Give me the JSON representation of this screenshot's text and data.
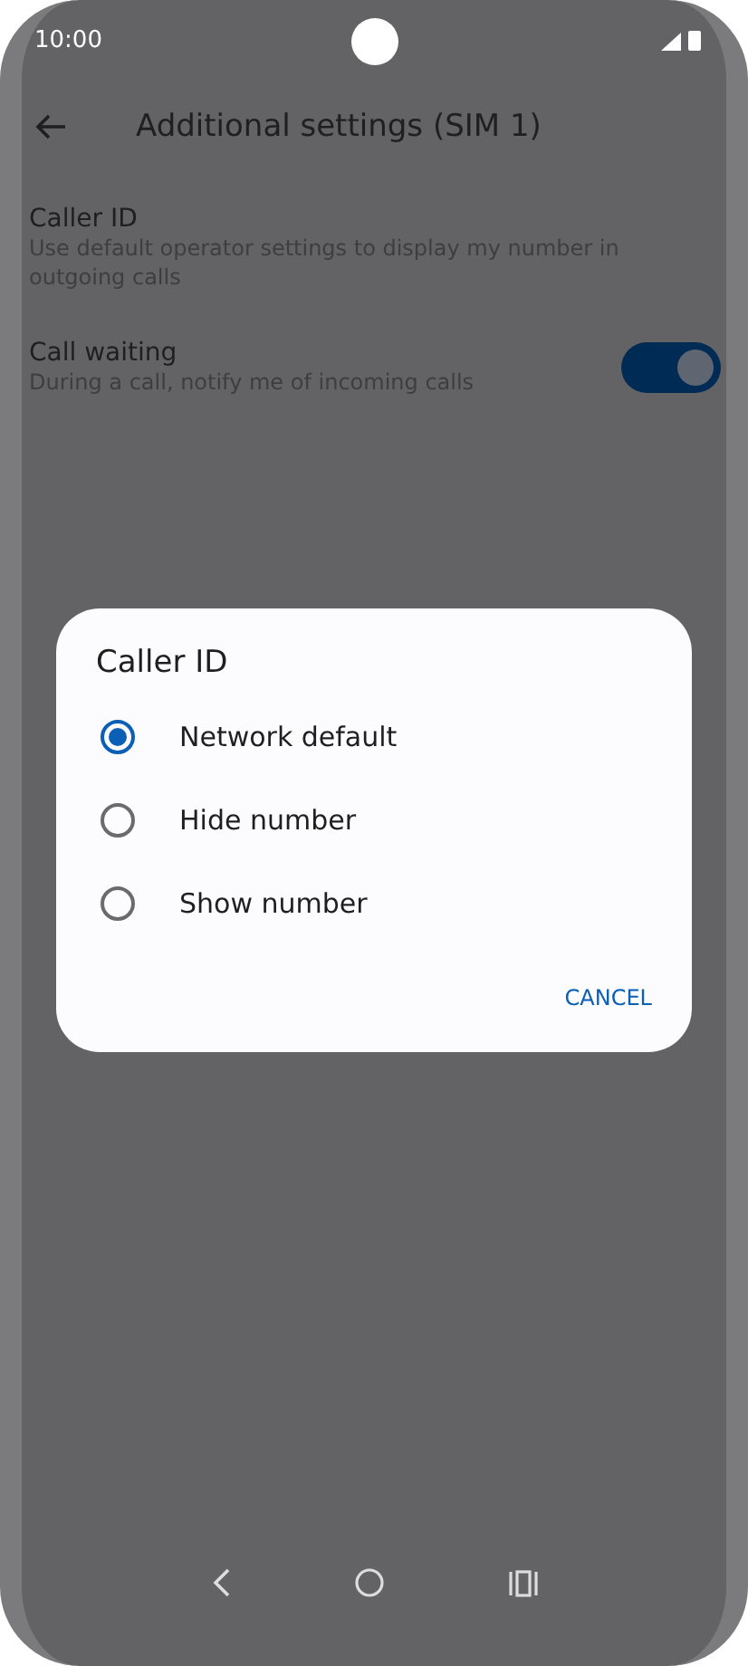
{
  "status_bar": {
    "time": "10:00"
  },
  "header": {
    "title": "Additional settings (SIM 1)"
  },
  "settings": [
    {
      "kind": "text",
      "title": "Caller ID",
      "subtitle": "Use default operator settings to display my number in outgoing calls"
    },
    {
      "kind": "switch",
      "title": "Call waiting",
      "subtitle": "During a call, notify me of incoming calls",
      "on": true
    }
  ],
  "dialog": {
    "title": "Caller ID",
    "options": [
      {
        "label": "Network default",
        "selected": true
      },
      {
        "label": "Hide number",
        "selected": false
      },
      {
        "label": "Show number",
        "selected": false
      }
    ],
    "buttons": [
      "CANCEL"
    ]
  }
}
